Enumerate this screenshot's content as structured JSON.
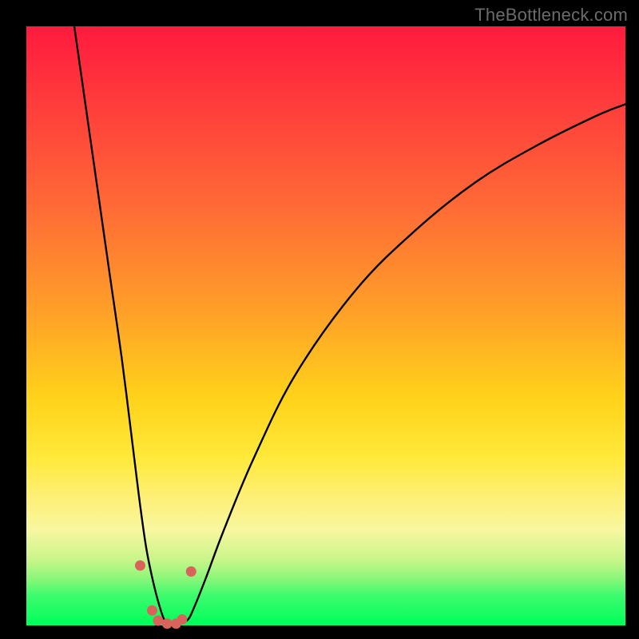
{
  "watermark": "TheBottleneck.com",
  "chart_data": {
    "type": "line",
    "title": "",
    "xlabel": "",
    "ylabel": "",
    "xlim": [
      0,
      100
    ],
    "ylim": [
      0,
      100
    ],
    "series": [
      {
        "name": "bottleneck-curve",
        "x": [
          8,
          10,
          12,
          14,
          16,
          18,
          19,
          20,
          21,
          22,
          23,
          24,
          25,
          26,
          27,
          28,
          30,
          33,
          38,
          45,
          55,
          65,
          75,
          85,
          95,
          100
        ],
        "values": [
          100,
          86,
          72,
          58,
          44,
          28,
          20,
          13,
          8,
          4,
          1,
          0,
          0,
          0.5,
          1,
          3,
          8,
          16,
          28,
          42,
          56,
          66,
          74,
          80,
          85,
          87
        ]
      }
    ],
    "highlight_points": {
      "comment": "small salmon/pink dots near the valley floor",
      "x": [
        19.0,
        21.0,
        22.0,
        23.5,
        25.0,
        26.0,
        27.5
      ],
      "values": [
        10.0,
        2.5,
        0.8,
        0.3,
        0.3,
        1,
        9.0
      ]
    },
    "colors": {
      "curve": "#000000",
      "dots": "#d9635b",
      "gradient_top": "#ff1a3e",
      "gradient_mid": "#ffd21a",
      "gradient_bottom": "#00ff5a",
      "frame": "#000000",
      "watermark": "#6b6b6b"
    }
  }
}
